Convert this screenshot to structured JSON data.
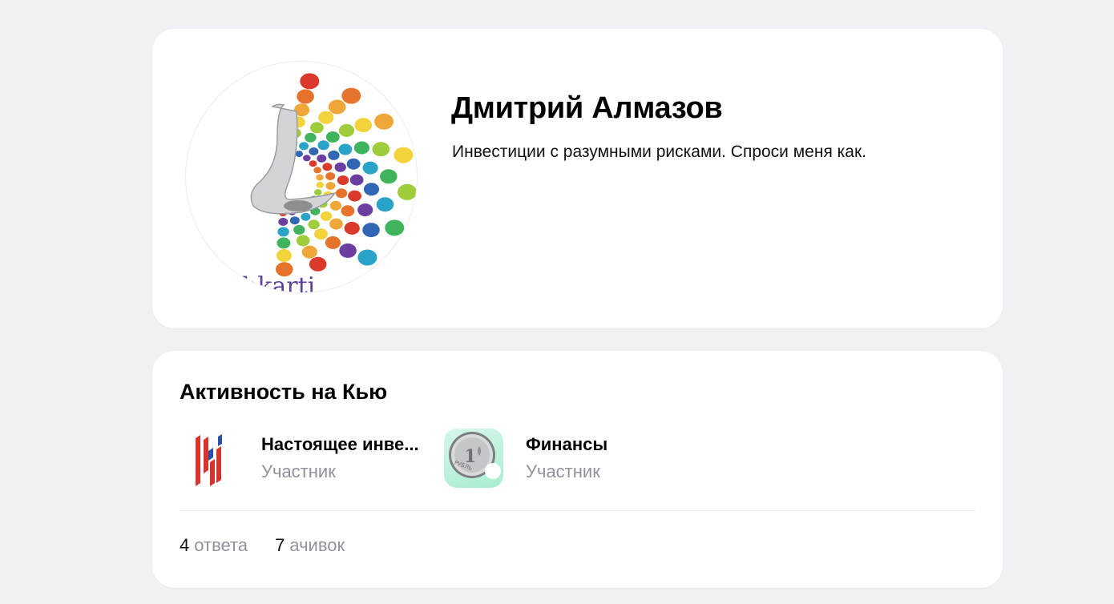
{
  "profile": {
    "name": "Дмитрий Алмазов",
    "bio": "Инвестиции с разумными рисками. Спроси меня как.",
    "avatar_icon": "rainbow-dots-logo",
    "avatar_watermark": "bkarti"
  },
  "activity": {
    "title": "Активность на Кью",
    "communities": [
      {
        "name": "Настоящее инвестирование",
        "display_name": "Настоящее инве...",
        "role": "Участник",
        "icon": "red-blue-bars-logo"
      },
      {
        "name": "Финансы",
        "display_name": "Финансы",
        "role": "Участник",
        "icon": "ruble-coin-icon"
      }
    ],
    "stats": [
      {
        "count": "4",
        "label": "ответа"
      },
      {
        "count": "7",
        "label": "ачивок"
      }
    ]
  },
  "colors": {
    "background": "#eff1f5",
    "card": "#ffffff",
    "muted_text": "#8f939c",
    "coin_bg": "#bff0d8"
  }
}
